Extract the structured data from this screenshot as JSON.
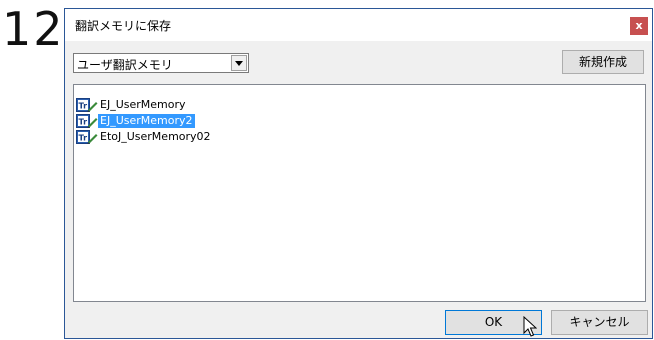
{
  "step": {
    "number": "12"
  },
  "dialog": {
    "title": "翻訳メモリに保存",
    "close_label": "x"
  },
  "combo": {
    "selected": "ユーザ翻訳メモリ",
    "arrow_icon": "chevron-down-icon"
  },
  "buttons": {
    "new_label": "新規作成",
    "ok_label": "OK",
    "cancel_label": "キャンセル"
  },
  "list": {
    "items": [
      {
        "label": "EJ_UserMemory",
        "selected": false,
        "icon": "translation-memory-icon"
      },
      {
        "label": "EJ_UserMemory2",
        "selected": true,
        "icon": "translation-memory-icon"
      },
      {
        "label": "EtoJ_UserMemory02",
        "selected": false,
        "icon": "translation-memory-icon"
      }
    ]
  },
  "colors": {
    "selection": "#3399ff",
    "close_button": "#c75050",
    "dialog_border": "#2b5797"
  }
}
